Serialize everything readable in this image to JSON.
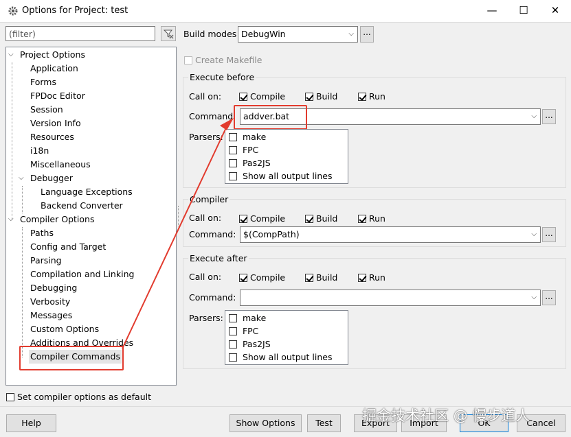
{
  "window": {
    "title": "Options for Project: test",
    "min_glyph": "—",
    "max_glyph": "☐",
    "close_glyph": "✕"
  },
  "filter": {
    "placeholder": "(filter)"
  },
  "tree": {
    "items": [
      {
        "label": "Project Options",
        "expanded": true
      },
      {
        "label": "Application"
      },
      {
        "label": "Forms"
      },
      {
        "label": "FPDoc Editor"
      },
      {
        "label": "Session"
      },
      {
        "label": "Version Info"
      },
      {
        "label": "Resources"
      },
      {
        "label": "i18n"
      },
      {
        "label": "Miscellaneous"
      },
      {
        "label": "Debugger",
        "expanded": true
      },
      {
        "label": "Language Exceptions"
      },
      {
        "label": "Backend Converter"
      },
      {
        "label": "Compiler Options",
        "expanded": true
      },
      {
        "label": "Paths"
      },
      {
        "label": "Config and Target"
      },
      {
        "label": "Parsing"
      },
      {
        "label": "Compilation and Linking"
      },
      {
        "label": "Debugging"
      },
      {
        "label": "Verbosity"
      },
      {
        "label": "Messages"
      },
      {
        "label": "Custom Options"
      },
      {
        "label": "Additions and Overrides"
      },
      {
        "label": "Compiler Commands",
        "selected": true
      }
    ]
  },
  "set_default": {
    "label": "Set compiler options as default",
    "checked": false
  },
  "build_modes": {
    "label": "Build modes",
    "value": "DebugWin",
    "more": "..."
  },
  "create_makefile": {
    "label": "Create Makefile",
    "checked": false,
    "enabled": false
  },
  "execute_before": {
    "title": "Execute before",
    "call_on_label": "Call on:",
    "compile": {
      "label": "Compile",
      "checked": true
    },
    "build": {
      "label": "Build",
      "checked": true
    },
    "run": {
      "label": "Run",
      "checked": true
    },
    "command_label": "Command:",
    "command_value": "addver.bat",
    "parsers_label": "Parsers:",
    "parsers": [
      {
        "label": "make",
        "checked": false
      },
      {
        "label": "FPC",
        "checked": false
      },
      {
        "label": "Pas2JS",
        "checked": false
      },
      {
        "label": "Show all output lines",
        "checked": false
      }
    ]
  },
  "compiler": {
    "title": "Compiler",
    "call_on_label": "Call on:",
    "compile": {
      "label": "Compile",
      "checked": true
    },
    "build": {
      "label": "Build",
      "checked": true
    },
    "run": {
      "label": "Run",
      "checked": true
    },
    "command_label": "Command:",
    "command_value": "$(CompPath)"
  },
  "execute_after": {
    "title": "Execute after",
    "call_on_label": "Call on:",
    "compile": {
      "label": "Compile",
      "checked": true
    },
    "build": {
      "label": "Build",
      "checked": true
    },
    "run": {
      "label": "Run",
      "checked": true
    },
    "command_label": "Command:",
    "command_value": "",
    "parsers_label": "Parsers:",
    "parsers": [
      {
        "label": "make",
        "checked": false
      },
      {
        "label": "FPC",
        "checked": false
      },
      {
        "label": "Pas2JS",
        "checked": false
      },
      {
        "label": "Show all output lines",
        "checked": false
      }
    ]
  },
  "buttons": {
    "help": "Help",
    "show_options": "Show Options",
    "test": "Test",
    "export": "Export",
    "import": "Import",
    "ok": "OK",
    "cancel": "Cancel"
  },
  "watermark": "掘金技术社区 @ 慢步道人",
  "colors": {
    "annotation_red": "#e23b2e",
    "accent": "#0078d7"
  },
  "icons": {
    "app": "gear-icon",
    "filter": "filter-clear-icon",
    "dropdown": "chevron-down-icon"
  }
}
